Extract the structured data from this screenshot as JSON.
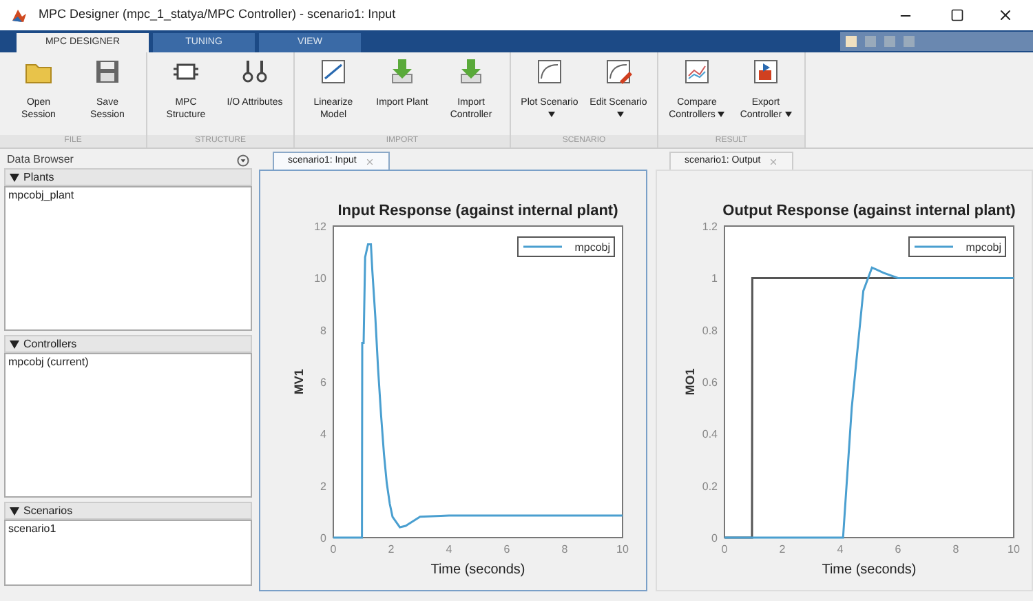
{
  "window": {
    "title": "MPC Designer (mpc_1_statya/MPC Controller) - scenario1: Input"
  },
  "ribbon_tabs": [
    {
      "label": "MPC DESIGNER",
      "selected": true
    },
    {
      "label": "TUNING",
      "selected": false
    },
    {
      "label": "VIEW",
      "selected": false
    }
  ],
  "toolbar_groups": [
    {
      "label": "FILE",
      "buttons": [
        {
          "label": "Open Session",
          "kind": "folder",
          "dropdown": false
        },
        {
          "label": "Save Session",
          "kind": "save",
          "dropdown": false
        }
      ]
    },
    {
      "label": "STRUCTURE",
      "buttons": [
        {
          "label": "MPC Structure",
          "kind": "chip",
          "dropdown": false
        },
        {
          "label": "I/O Attributes",
          "kind": "io",
          "dropdown": false
        }
      ]
    },
    {
      "label": "IMPORT",
      "buttons": [
        {
          "label": "Linearize Model",
          "kind": "linearize",
          "dropdown": false
        },
        {
          "label": "Import Plant",
          "kind": "import",
          "dropdown": false
        },
        {
          "label": "Import Controller",
          "kind": "import",
          "dropdown": false
        }
      ]
    },
    {
      "label": "SCENARIO",
      "buttons": [
        {
          "label": "Plot Scenario",
          "kind": "plot",
          "dropdown": true
        },
        {
          "label": "Edit Scenario",
          "kind": "edit",
          "dropdown": true
        }
      ]
    },
    {
      "label": "RESULT",
      "buttons": [
        {
          "label": "Compare Controllers",
          "kind": "compare",
          "dropdown": true
        },
        {
          "label": "Export Controller",
          "kind": "export",
          "dropdown": true
        }
      ]
    }
  ],
  "data_browser": {
    "title": "Data Browser",
    "sections": [
      {
        "label": "Plants",
        "expanded": true,
        "items": [
          "mpcobj_plant"
        ]
      },
      {
        "label": "Controllers",
        "expanded": true,
        "items": [
          "mpcobj (current)"
        ]
      },
      {
        "label": "Scenarios",
        "expanded": true,
        "items": [
          "scenario1"
        ]
      }
    ]
  },
  "documents": [
    {
      "tab": "scenario1: Input",
      "selected": true,
      "chart_data": {
        "type": "line",
        "title": "Input Response (against internal plant)",
        "xlabel": "Time (seconds)",
        "ylabel": "MV1",
        "x": [
          0,
          0.99,
          1.0,
          1.05,
          1.1,
          1.2,
          1.3,
          1.35,
          1.45,
          1.55,
          1.65,
          1.75,
          1.85,
          1.95,
          2.05,
          2.3,
          2.5,
          3,
          4,
          10
        ],
        "series": [
          {
            "name": "mpcobj",
            "color": "#4a9fd0",
            "values": [
              0,
              0,
              7.5,
              7.5,
              10.8,
              11.3,
              11.3,
              10.3,
              8.5,
              6.5,
              4.7,
              3.2,
              2.1,
              1.3,
              0.8,
              0.4,
              0.45,
              0.8,
              0.85,
              0.85
            ]
          }
        ],
        "xlim": [
          0,
          10
        ],
        "ylim": [
          0,
          12
        ],
        "xticks": [
          0,
          2,
          4,
          6,
          8,
          10
        ],
        "yticks": [
          0,
          2,
          4,
          6,
          8,
          10,
          12
        ]
      }
    },
    {
      "tab": "scenario1: Output",
      "selected": false,
      "chart_data": {
        "type": "line",
        "title": "Output Response (against internal plant)",
        "xlabel": "Time (seconds)",
        "ylabel": "MO1",
        "x": [
          0,
          0.95,
          0.96,
          4.1,
          4.4,
          4.8,
          5.1,
          5.5,
          6,
          10
        ],
        "series": [
          {
            "color": "#555555",
            "values": [
              0,
              0,
              1,
              1,
              1,
              1,
              1,
              1,
              1,
              1
            ]
          },
          {
            "name": "mpcobj",
            "color": "#4a9fd0",
            "values": [
              0,
              0,
              0,
              0,
              0.5,
              0.95,
              1.04,
              1.02,
              1,
              1
            ]
          }
        ],
        "xlim": [
          0,
          10
        ],
        "ylim": [
          0,
          1.2
        ],
        "xticks": [
          0,
          2,
          4,
          6,
          8,
          10
        ],
        "yticks": [
          0,
          0.2,
          0.4,
          0.6,
          0.8,
          1,
          1.2
        ]
      }
    }
  ]
}
